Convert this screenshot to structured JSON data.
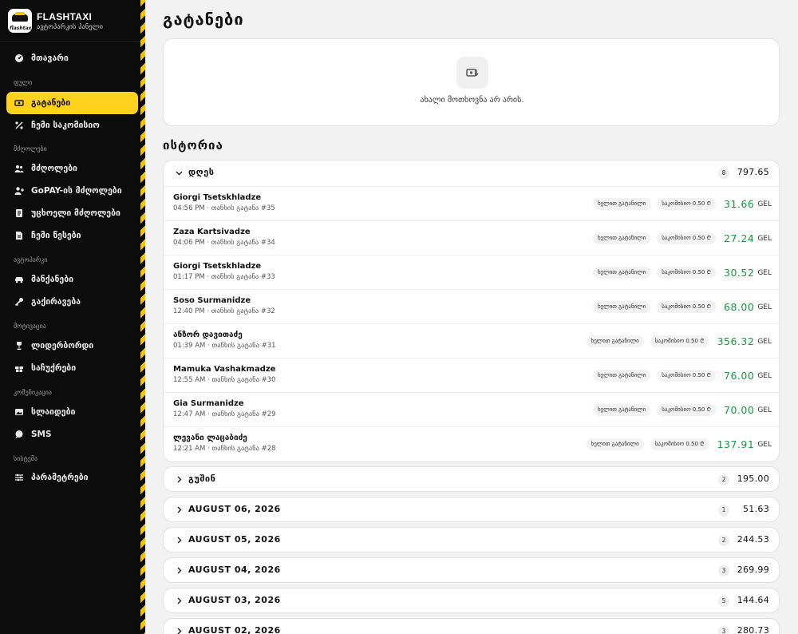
{
  "brand": {
    "name": "FLASHTAXI",
    "subtitle": "ავტოპარკის პანელი",
    "logo_text": "flashtaxi"
  },
  "sidebar": {
    "top_item": {
      "label": "მთავარი",
      "icon": "dashboard-icon"
    },
    "sections": [
      {
        "label": "ფული",
        "items": [
          {
            "label": "გატანები",
            "icon": "withdraw-icon",
            "active": true
          },
          {
            "label": "ჩემი საკომისიო",
            "icon": "percent-icon"
          }
        ]
      },
      {
        "label": "მძღოლები",
        "items": [
          {
            "label": "მძღოლები",
            "icon": "users-icon"
          },
          {
            "label": "GoPAY-ის მძღოლები",
            "icon": "user-plus-icon"
          },
          {
            "label": "უცხოელი მძღოლები",
            "icon": "document-icon"
          },
          {
            "label": "ჩემი წესები",
            "icon": "file-icon"
          }
        ]
      },
      {
        "label": "ავტოპარკი",
        "items": [
          {
            "label": "მანქანები",
            "icon": "car-icon"
          },
          {
            "label": "გაქირავება",
            "icon": "key-icon"
          }
        ]
      },
      {
        "label": "მოტივაცია",
        "items": [
          {
            "label": "ლიდერბორდი",
            "icon": "trophy-icon"
          },
          {
            "label": "საჩუქრები",
            "icon": "gift-icon"
          }
        ]
      },
      {
        "label": "კომუნიკაცია",
        "items": [
          {
            "label": "სლაიდები",
            "icon": "slides-icon"
          },
          {
            "label": "SMS",
            "icon": "chat-icon"
          }
        ]
      },
      {
        "label": "სისტემა",
        "items": [
          {
            "label": "პარამეტრები",
            "icon": "sliders-icon"
          }
        ]
      }
    ]
  },
  "main": {
    "title": "გატანები",
    "empty_text": "ახალი მოთხოვნა არ არის.",
    "history_title": "ისტორია",
    "groups": [
      {
        "label": "დღეს",
        "count": "8",
        "total": "797.65",
        "expanded": true,
        "rows": [
          {
            "name": "Giorgi Tsetskhladze",
            "meta": "04:56 PM · თანხის გატანა #35",
            "tag1": "ხელით გატანილი",
            "tag2": "საკომისიო 0.50 ₾",
            "amount": "31.66",
            "currency": "GEL"
          },
          {
            "name": "Zaza Kartsivadze",
            "meta": "04:06 PM · თანხის გატანა #34",
            "tag1": "ხელით გატანილი",
            "tag2": "საკომისიო 0.50 ₾",
            "amount": "27.24",
            "currency": "GEL"
          },
          {
            "name": "Giorgi Tsetskhladze",
            "meta": "01:17 PM · თანხის გატანა #33",
            "tag1": "ხელით გატანილი",
            "tag2": "საკომისიო 0.50 ₾",
            "amount": "30.52",
            "currency": "GEL"
          },
          {
            "name": "Soso Surmanidze",
            "meta": "12:40 PM · თანხის გატანა #32",
            "tag1": "ხელით გატანილი",
            "tag2": "საკომისიო 0.50 ₾",
            "amount": "68.00",
            "currency": "GEL"
          },
          {
            "name": "ანზორ დავითაძე",
            "meta": "01:39 AM · თანხის გატანა #31",
            "tag1": "ხელით გატანილი",
            "tag2": "საკომისიო 0.50 ₾",
            "amount": "356.32",
            "currency": "GEL"
          },
          {
            "name": "Mamuka Vashakmadze",
            "meta": "12:55 AM · თანხის გატანა #30",
            "tag1": "ხელით გატანილი",
            "tag2": "საკომისიო 0.50 ₾",
            "amount": "76.00",
            "currency": "GEL"
          },
          {
            "name": "Gia Surmanidze",
            "meta": "12:47 AM · თანხის გატანა #29",
            "tag1": "ხელით გატანილი",
            "tag2": "საკომისიო 0.50 ₾",
            "amount": "70.00",
            "currency": "GEL"
          },
          {
            "name": "ლევანი ლაცაბიძე",
            "meta": "12:21 AM · თანხის გატანა #28",
            "tag1": "ხელით გატანილი",
            "tag2": "საკომისიო 0.50 ₾",
            "amount": "137.91",
            "currency": "GEL"
          }
        ]
      },
      {
        "label": "გუშინ",
        "count": "2",
        "total": "195.00",
        "expanded": false
      },
      {
        "label": "AUGUST 06, 2026",
        "count": "1",
        "total": "51.63",
        "expanded": false
      },
      {
        "label": "AUGUST 05, 2026",
        "count": "2",
        "total": "244.53",
        "expanded": false
      },
      {
        "label": "AUGUST 04, 2026",
        "count": "3",
        "total": "269.99",
        "expanded": false
      },
      {
        "label": "AUGUST 03, 2026",
        "count": "5",
        "total": "144.64",
        "expanded": false
      },
      {
        "label": "AUGUST 02, 2026",
        "count": "3",
        "total": "280.73",
        "expanded": false
      }
    ]
  }
}
